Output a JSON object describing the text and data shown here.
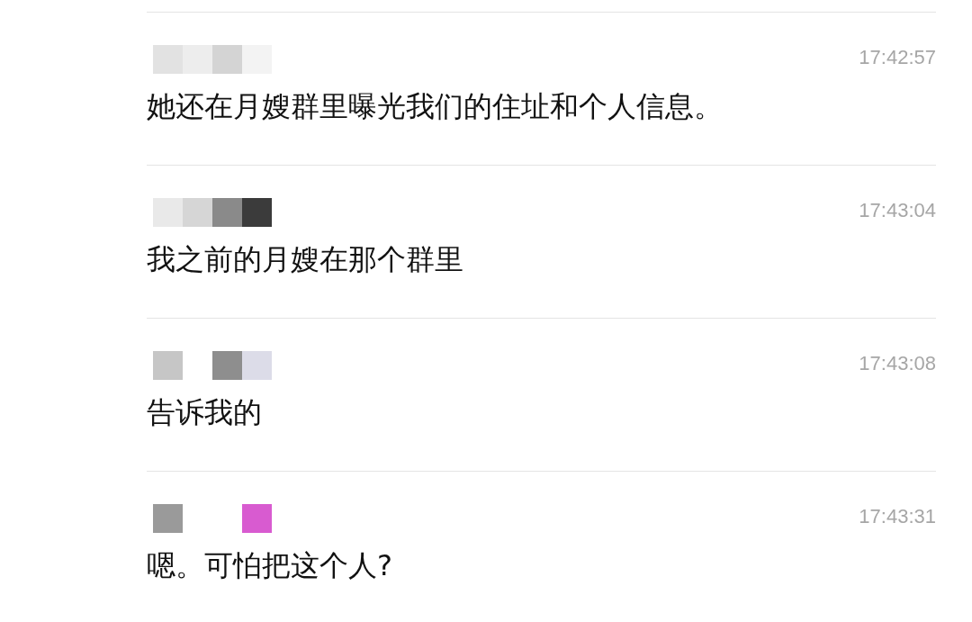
{
  "messages": [
    {
      "time": "17:42:57",
      "text": "她还在月嫂群里曝光我们的住址和个人信息。"
    },
    {
      "time": "17:43:04",
      "text": "我之前的月嫂在那个群里"
    },
    {
      "time": "17:43:08",
      "text": "告诉我的"
    },
    {
      "time": "17:43:31",
      "text": "嗯。可怕把这个人?"
    }
  ]
}
